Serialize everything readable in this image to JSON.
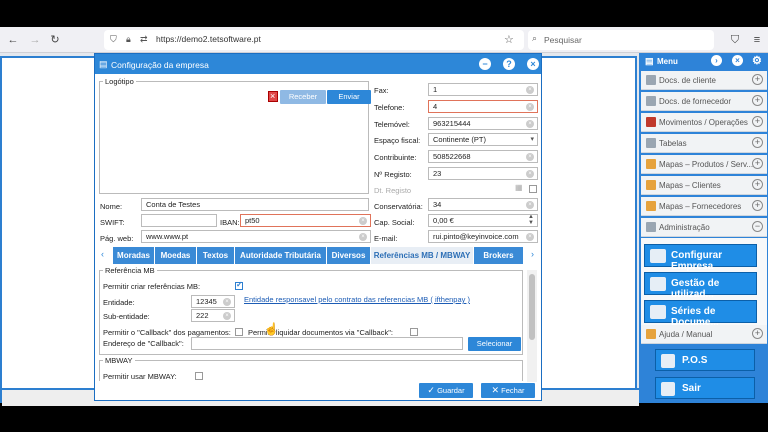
{
  "browser": {
    "url": "https://demo2.tetsoftware.pt",
    "search_placeholder": "Pesquisar"
  },
  "menu": {
    "title": "Menu",
    "items": [
      {
        "label": "Docs. de cliente"
      },
      {
        "label": "Docs. de fornecedor"
      },
      {
        "label": "Movimentos / Operações"
      },
      {
        "label": "Tabelas"
      },
      {
        "label": "Mapas – Produtos / Serv..."
      },
      {
        "label": "Mapas – Clientes"
      },
      {
        "label": "Mapas – Fornecedores"
      },
      {
        "label": "Administração"
      }
    ],
    "admin_buttons": [
      {
        "label": "Configurar Empresa"
      },
      {
        "label": "Gestão de utilizad..."
      },
      {
        "label": "Séries de Docume..."
      }
    ],
    "help_item": "Ajuda / Manual",
    "pos_label": "P.O.S",
    "exit_label": "Sair"
  },
  "dialog": {
    "title": "Configuração da empresa",
    "logo": {
      "legend": "Logótipo",
      "receive_label": "Receber",
      "send_label": "Enviar"
    },
    "left_fields": {
      "nome_label": "Nome:",
      "nome_value": "Conta de Testes",
      "swift_label": "SWIFT:",
      "swift_value": "",
      "iban_label": "IBAN:",
      "iban_value": "pt50",
      "pagweb_label": "Pág. web:",
      "pagweb_value": "www.www.pt"
    },
    "right_fields": {
      "fax_label": "Fax:",
      "fax_value": "1",
      "telefone_label": "Telefone:",
      "telefone_value": "4",
      "telemovel_label": "Telemóvel:",
      "telemovel_value": "963215444",
      "espaco_label": "Espaço fiscal:",
      "espaco_value": "Continente (PT)",
      "contribuinte_label": "Contribuinte:",
      "contribuinte_value": "508522668",
      "registo_label": "Nº Registo:",
      "registo_value": "23",
      "dtregisto_label": "Dt. Registo",
      "conservatoria_label": "Conservatória:",
      "conservatoria_value": "34",
      "capsocial_label": "Cap. Social:",
      "capsocial_value": "0,00 €",
      "email_label": "E-mail:",
      "email_value": "rui.pinto@keyinvoice.com"
    },
    "tabs": [
      {
        "label": "Moradas"
      },
      {
        "label": "Moedas"
      },
      {
        "label": "Textos"
      },
      {
        "label": "Autoridade Tributária"
      },
      {
        "label": "Diversos"
      },
      {
        "label": "Referências MB / MBWAY"
      },
      {
        "label": "Brokers Fatu..."
      }
    ],
    "mb": {
      "legend": "Referência MB",
      "permitir_label": "Permitir criar referências MB:",
      "entidade_label": "Entidade:",
      "entidade_value": "12345",
      "subentidade_label": "Sub-entidade:",
      "subentidade_value": "222",
      "link_text": "Entidade responsavel pelo contrato das referencias MB ( ifthenpay )",
      "callback_label": "Permitir o \"Callback\" dos pagamentos:",
      "liquidar_label": "Permitir liquidar documentos via \"Callback\":",
      "endereco_label": "Endereço de \"Callback\":",
      "selecionar_label": "Selecionar"
    },
    "mbway": {
      "legend": "MBWAY",
      "permitir_label": "Permitir usar MBWAY:"
    },
    "save_label": "Guardar",
    "close_label": "Fechar"
  }
}
